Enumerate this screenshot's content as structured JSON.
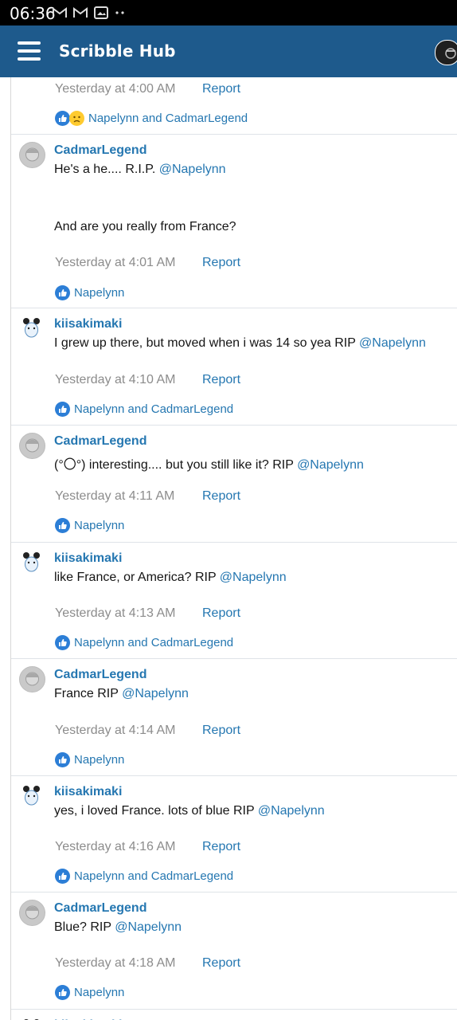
{
  "status_bar": {
    "time": "06:36",
    "icons": [
      "gmail-icon",
      "gmail-icon",
      "image-icon",
      "dots-icon"
    ]
  },
  "app_bar": {
    "title": "Scribble Hub"
  },
  "colors": {
    "app_bar": "#1e5a8c",
    "link": "#2577b1",
    "like": "#2c7ed6",
    "meta": "#8c8c8c"
  },
  "top_partial": {
    "time": "Yesterday at 4:00 AM",
    "report": "Report",
    "likes": "Napelynn and CadmarLegend"
  },
  "messages": [
    {
      "user": "CadmarLegend",
      "line1": "He's a he.... R.I.P. ",
      "mention": "@Napelynn",
      "line2": "And are you really from France?",
      "time": "Yesterday at 4:01 AM",
      "report": "Report",
      "likes": "Napelynn"
    },
    {
      "user": "kiisakimaki",
      "line1": "I grew up there, but moved when i was 14 so yea RIP ",
      "mention": "@Napelynn",
      "time": "Yesterday at 4:10 AM",
      "report": "Report",
      "likes": "Napelynn and CadmarLegend"
    },
    {
      "user": "CadmarLegend",
      "line1": "(°〇°) interesting.... but you still like it? RIP ",
      "mention": "@Napelynn",
      "time": "Yesterday at 4:11 AM",
      "report": "Report",
      "likes": "Napelynn"
    },
    {
      "user": "kiisakimaki",
      "line1": "like France, or America? RIP ",
      "mention": "@Napelynn",
      "time": "Yesterday at 4:13 AM",
      "report": "Report",
      "likes": "Napelynn and CadmarLegend"
    },
    {
      "user": "CadmarLegend",
      "line1": "France RIP ",
      "mention": "@Napelynn",
      "time": "Yesterday at 4:14 AM",
      "report": "Report",
      "likes": "Napelynn"
    },
    {
      "user": "kiisakimaki",
      "line1": "yes, i loved France. lots of blue RIP ",
      "mention": "@Napelynn",
      "time": "Yesterday at 4:16 AM",
      "report": "Report",
      "likes": "Napelynn and CadmarLegend"
    },
    {
      "user": "CadmarLegend",
      "line1": "Blue? RIP ",
      "mention": "@Napelynn",
      "time": "Yesterday at 4:18 AM",
      "report": "Report",
      "likes": "Napelynn"
    }
  ],
  "bottom_partial": {
    "user": "kiisakimaki"
  }
}
